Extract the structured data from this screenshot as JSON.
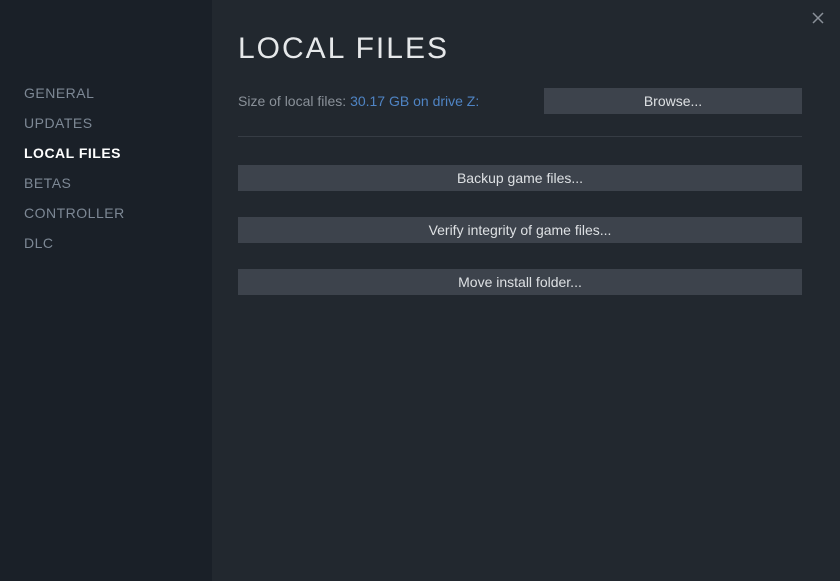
{
  "sidebar": {
    "items": [
      {
        "label": "GENERAL"
      },
      {
        "label": "UPDATES"
      },
      {
        "label": "LOCAL FILES"
      },
      {
        "label": "BETAS"
      },
      {
        "label": "CONTROLLER"
      },
      {
        "label": "DLC"
      }
    ]
  },
  "main": {
    "title": "LOCAL FILES",
    "size_label": "Size of local files: ",
    "size_value": "30.17 GB on drive Z:",
    "browse_label": "Browse...",
    "backup_label": "Backup game files...",
    "verify_label": "Verify integrity of game files...",
    "move_label": "Move install folder..."
  }
}
